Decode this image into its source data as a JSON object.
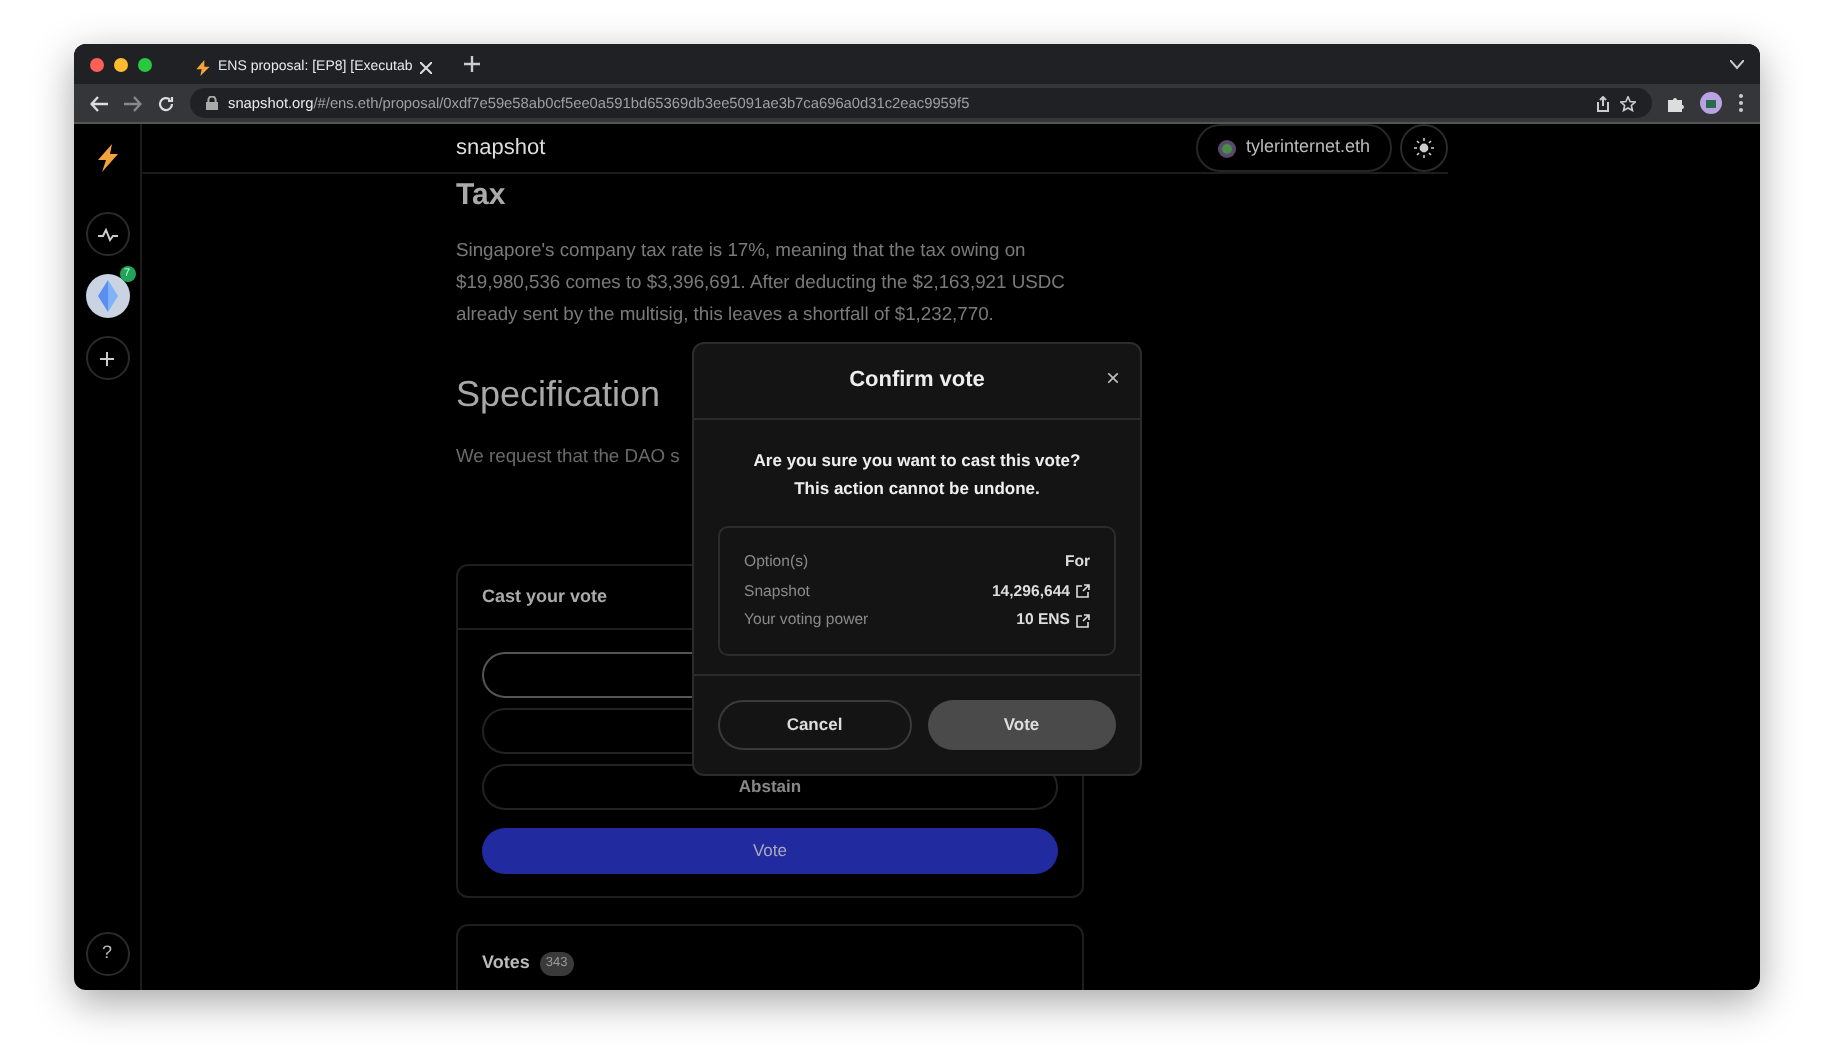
{
  "browser": {
    "tab_title": "ENS proposal: [EP8] [Executab",
    "url_host": "snapshot.org",
    "url_path": "/#/ens.eth/proposal/0xdf7e59e58ab0cf5ee0a591bd65369db3ee5091ae3b7ca696a0d31c2eac9959f5"
  },
  "sidebar": {
    "space_badge": "7",
    "help": "?"
  },
  "header": {
    "brand": "snapshot",
    "account": "tylerinternet.eth"
  },
  "proposal": {
    "heading": "Tax",
    "paragraph": "Singapore's company tax rate is 17%, meaning that the tax owing on $19,980,536 comes to $3,396,691. After deducting the $2,163,921 USDC already sent by the multisig, this leaves a shortfall of $1,232,770.",
    "section_heading": "Specification",
    "section_text": "We request that the DAO s"
  },
  "cast_vote": {
    "title": "Cast your vote",
    "options": [
      {
        "selected": true
      },
      {
        "selected": false
      },
      {
        "label": "Abstain",
        "selected": false
      }
    ],
    "button": "Vote"
  },
  "votes": {
    "title": "Votes",
    "count": "343"
  },
  "modal": {
    "title": "Confirm vote",
    "close": "×",
    "question": "Are you sure you want to cast this vote?",
    "warning": "This action cannot be undone.",
    "details": [
      {
        "label": "Option(s)",
        "value": "For",
        "link": false
      },
      {
        "label": "Snapshot",
        "value": "14,296,644",
        "link": true
      },
      {
        "label": "Your voting power",
        "value": "10 ENS",
        "link": true
      }
    ],
    "cancel": "Cancel",
    "confirm": "Vote"
  }
}
